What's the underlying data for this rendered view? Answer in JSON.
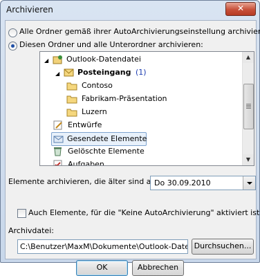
{
  "window": {
    "title": "Archivieren",
    "close_label": "✕"
  },
  "options": {
    "all_folders": "Alle Ordner gemäß ihrer AutoArchivierungseinstellung archivieren",
    "this_folder": "Diesen Ordner und alle Unterordner archivieren:"
  },
  "tree": {
    "root": "Outlook-Datendatei",
    "inbox": "Posteingang",
    "inbox_count": "(1)",
    "sub1": "Contoso",
    "sub2": "Fabrikam-Präsentation",
    "sub3": "Luzern",
    "drafts": "Entwürfe",
    "sent": "Gesendete Elemente",
    "deleted": "Gelöschte Elemente",
    "tasks": "Aufgaben"
  },
  "older_than": {
    "label": "Elemente archivieren, die älter sind als:",
    "value": "Do 30.09.2010"
  },
  "include_checkbox": "Auch Elemente, für die \"Keine AutoArchivierung\" aktiviert ist.",
  "archive_file": {
    "label": "Archivdatei:",
    "path": "C:\\Benutzer\\MaxM\\Dokumente\\Outlook-Dateien\\A",
    "browse": "Durchsuchen..."
  },
  "buttons": {
    "ok": "OK",
    "cancel": "Abbrechen"
  },
  "colors": {
    "accent": "#1e4fa6",
    "inbox_count": "#1a3ab0"
  }
}
